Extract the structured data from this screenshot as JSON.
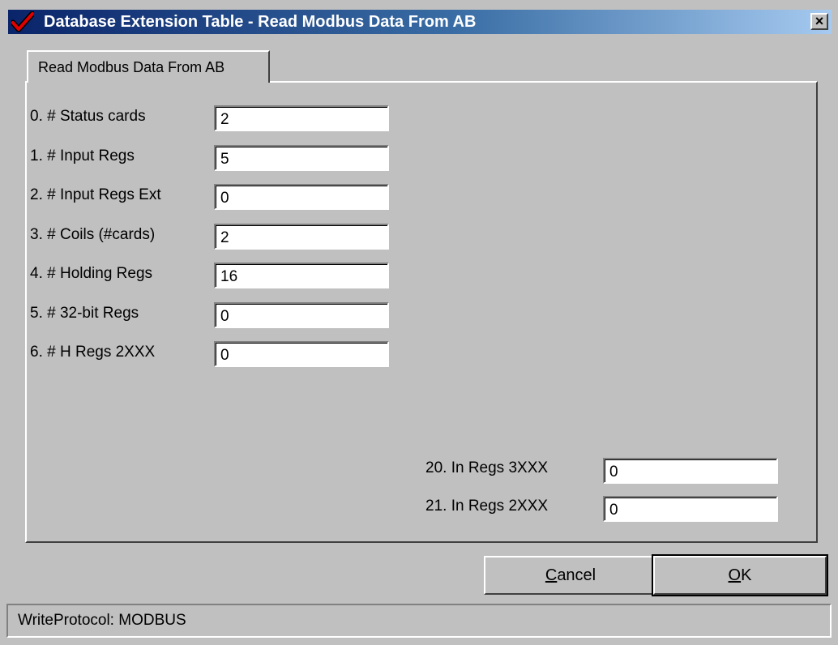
{
  "window": {
    "title": "Database Extension Table - Read Modbus Data From AB",
    "close_glyph": "×"
  },
  "tabs": [
    {
      "label": "Read Modbus Data From AB",
      "active": true
    }
  ],
  "fields_left": [
    {
      "label": "0. # Status cards",
      "value": "2"
    },
    {
      "label": "1. # Input Regs",
      "value": "5"
    },
    {
      "label": "2. # Input Regs Ext",
      "value": "0"
    },
    {
      "label": "3. # Coils (#cards)",
      "value": "2"
    },
    {
      "label": "4. # Holding Regs",
      "value": "16"
    },
    {
      "label": "5. # 32-bit Regs",
      "value": "0"
    },
    {
      "label": "6. # H Regs 2XXX",
      "value": "0"
    }
  ],
  "fields_right": [
    {
      "label": "20. In Regs 3XXX",
      "value": "0"
    },
    {
      "label": "21. In Regs 2XXX",
      "value": "0"
    }
  ],
  "buttons": {
    "cancel_prefix": "",
    "cancel_accel": "C",
    "cancel_rest": "ancel",
    "ok_prefix": "",
    "ok_accel": "O",
    "ok_rest": "K"
  },
  "status": {
    "text": "WriteProtocol: MODBUS"
  },
  "colors": {
    "titlebar_start": "#0a246a",
    "titlebar_end": "#a6caf0",
    "face": "#c0c0c0",
    "checkmark": "#e00000"
  }
}
